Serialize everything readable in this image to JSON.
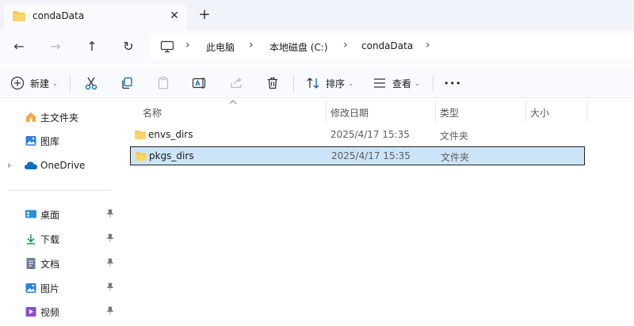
{
  "tab": {
    "title": "condaData",
    "close": "✕",
    "new": "+"
  },
  "nav": {
    "back": "←",
    "forward": "→",
    "up": "↑",
    "refresh": "↻"
  },
  "breadcrumb": {
    "items": [
      "此电脑",
      "本地磁盘 (C:)",
      "condaData"
    ],
    "separator": "›"
  },
  "toolbar": {
    "new_label": "新建",
    "sort_label": "排序",
    "view_label": "查看",
    "more": "•••",
    "dropdown": "⌄"
  },
  "sidebar": {
    "items": [
      {
        "label": "主文件夹",
        "icon": "home-icon"
      },
      {
        "label": "图库",
        "icon": "gallery-icon"
      },
      {
        "label": "OneDrive",
        "icon": "cloud-icon"
      }
    ],
    "pinned": [
      {
        "label": "桌面",
        "icon": "desktop-icon"
      },
      {
        "label": "下载",
        "icon": "download-icon"
      },
      {
        "label": "文档",
        "icon": "document-icon"
      },
      {
        "label": "图片",
        "icon": "pictures-icon"
      },
      {
        "label": "视频",
        "icon": "video-icon"
      }
    ],
    "pin_glyph": "📌",
    "expand_glyph": "›"
  },
  "columns": {
    "name": "名称",
    "modified": "修改日期",
    "type": "类型",
    "size": "大小"
  },
  "files": [
    {
      "name": "envs_dirs",
      "modified": "2025/4/17 15:35",
      "type": "文件夹",
      "selected": false
    },
    {
      "name": "pkgs_dirs",
      "modified": "2025/4/17 15:35",
      "type": "文件夹",
      "selected": true
    }
  ],
  "colors": {
    "accent": "#0067c0",
    "folder": "#f8c94a",
    "selection": "#cce4f7",
    "chrome": "#f0f3f9"
  }
}
